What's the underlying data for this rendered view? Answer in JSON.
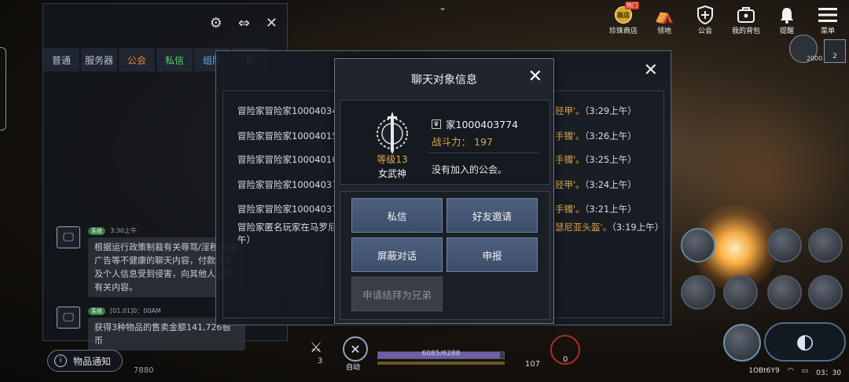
{
  "top_menu": [
    {
      "name": "shop",
      "label": "珍珠商店",
      "icon": "shop-icon",
      "badge": "热门",
      "badge_inner": "商店"
    },
    {
      "name": "camp",
      "label": "领地",
      "icon": "tent-icon"
    },
    {
      "name": "guild",
      "label": "公会",
      "icon": "shield-icon"
    },
    {
      "name": "bag",
      "label": "我的背包",
      "icon": "bag-icon"
    },
    {
      "name": "alert",
      "label": "提醒",
      "icon": "bell-icon"
    },
    {
      "name": "menu",
      "label": "菜单",
      "icon": "hamburger-icon"
    }
  ],
  "chat": {
    "tabs": [
      "普通",
      "服务器",
      "公会",
      "私信",
      "组队",
      "先"
    ],
    "messages": [
      {
        "tag": "系统",
        "time": "3:30上午",
        "text": "根据运行政策制裁有关辱骂/淫秽内容/广告等不健康的聊天内容，付款信息及个人信息受到侵害，向其他人公开有关内容。"
      },
      {
        "tag": "系统",
        "time": "[01.01]0：00AM",
        "text": "获得3种物品的售卖金额141,726银币"
      }
    ],
    "item_notice": "物品通知"
  },
  "list_dialog": {
    "rows": [
      {
        "left": "冒险家冒险家10004034",
        "right": "胫甲'。",
        "time": "（3:29上午）"
      },
      {
        "left": "冒险家冒险家10004015",
        "right": "手镯'。",
        "time": "（3:26上午）"
      },
      {
        "left": "冒险家冒险家10004016",
        "right": "手镯'。",
        "time": "（3:25上午）"
      },
      {
        "left": "冒险家冒险家10004037",
        "right": "胫甲'。",
        "time": "（3:24上午）"
      },
      {
        "left": "冒险家冒险家10004037",
        "right": "手镯'。",
        "time": "（3:21上午）"
      },
      {
        "left": "冒险家匿名玩家在马罗尼",
        "right": "瑟尼亚头盔'。",
        "time": "（3:19上午）"
      }
    ],
    "wrap_tail": "午）"
  },
  "detail": {
    "title": "聊天对象信息",
    "level": "等级13",
    "class": "女武神",
    "name": "家1000403774",
    "power_label": "战斗力：",
    "power_value": "197",
    "guild": "没有加入的公会。",
    "buttons": {
      "whisper": "私信",
      "friend": "好友邀请",
      "block": "屏蔽对话",
      "report": "申报",
      "brother": "申请结拜为兄弟"
    }
  },
  "hud": {
    "left_num": "3",
    "auto_label": "自动",
    "xp_text": "6085/6288",
    "xp_progress": 0.97,
    "level_num": "107",
    "potion_count": "0",
    "silver": "7880",
    "minimap_val": "2000",
    "map_val": "2"
  },
  "status_bar": {
    "id": "1OBt6Y9",
    "time": "03：30"
  },
  "colors": {
    "accent_gold": "#e5a43b",
    "button_blue": "#4c5f7e",
    "guild_tab": "#e8843a",
    "whisper_tab": "#5fd46b"
  }
}
